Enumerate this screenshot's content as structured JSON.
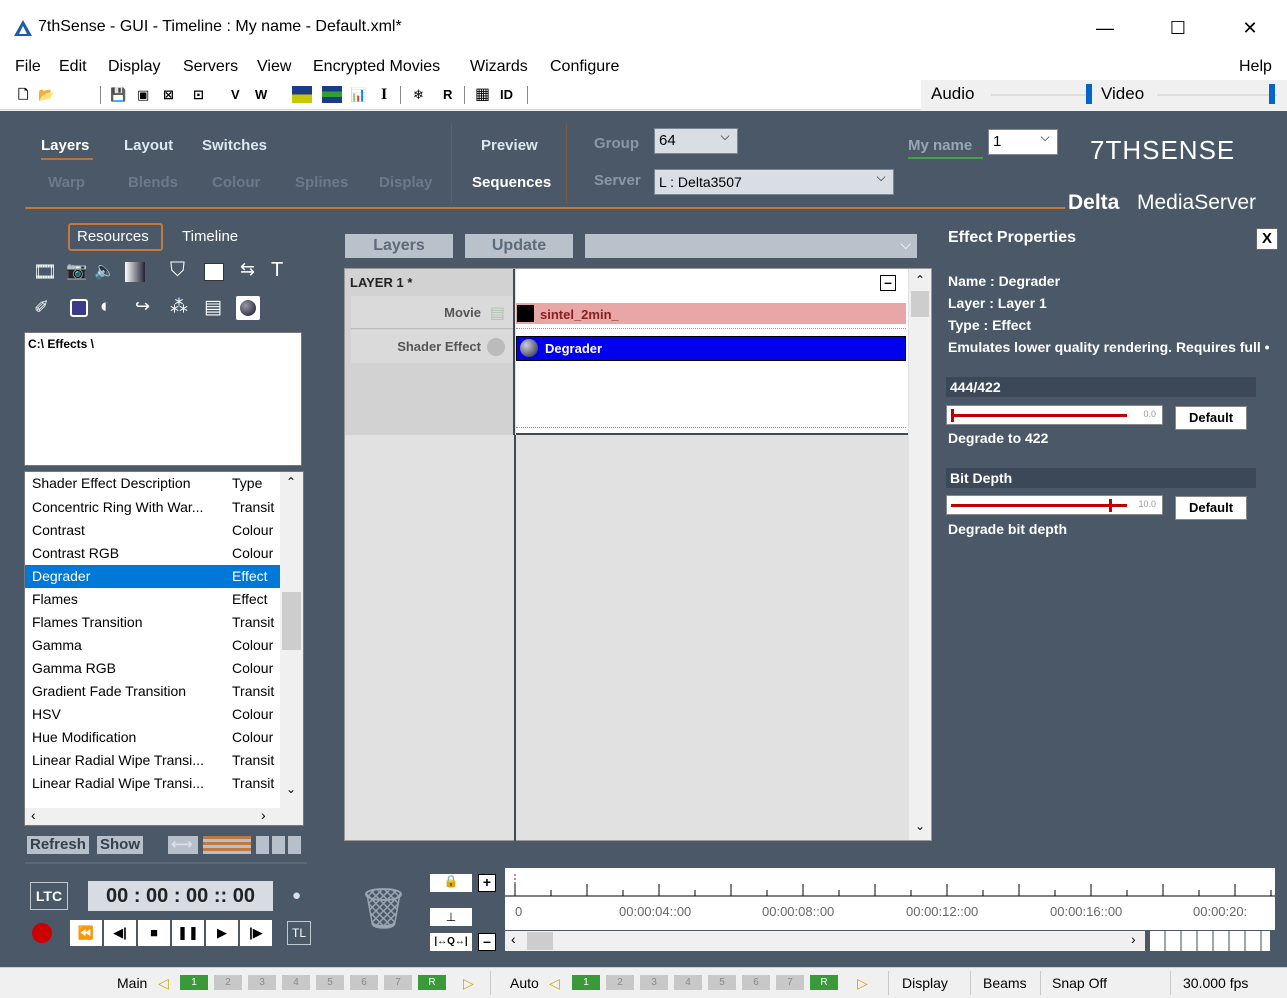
{
  "window": {
    "title": "7thSense -   GUI  - Timeline  : My name  - Default.xml*",
    "minimize": "—",
    "maximize": "☐",
    "close": "✕"
  },
  "menu": [
    "File",
    "Edit",
    "Display",
    "Servers",
    "View",
    "Encrypted Movies",
    "Wizards",
    "Configure",
    "Help"
  ],
  "toolbar": {
    "icons": [
      "new-file",
      "open-folder",
      "save",
      "properties",
      "grid-a",
      "grid-b",
      "V",
      "W",
      "chart-a",
      "chart-b",
      "bars",
      "I",
      "snowflake",
      "R",
      "table",
      "ID"
    ],
    "letter_v": "V",
    "letter_w": "W",
    "letter_i": "I",
    "letter_r": "R",
    "letter_id": "ID",
    "audio_label": "Audio",
    "video_label": "Video",
    "audio_level": 0.95,
    "video_level": 0.98
  },
  "nav": {
    "row1": [
      "Layers",
      "Layout",
      "Switches"
    ],
    "row2": [
      "Warp",
      "Blends",
      "Colour",
      "Splines",
      "Display"
    ],
    "preview": "Preview",
    "sequences": "Sequences",
    "group_label": "Group",
    "group_value": "64",
    "server_label": "Server",
    "server_value": "L : Delta3507",
    "user_label": "My name",
    "user_value": "1",
    "brand": "7THSENSE",
    "product_bold": "Delta",
    "product_light": "MediaServer"
  },
  "left": {
    "tab_resources": "Resources",
    "tab_timeline": "Timeline",
    "path": "C:\\ Effects \\",
    "col_desc": "Shader Effect Description",
    "col_type": "Type",
    "rows": [
      {
        "desc": "Concentric Ring With War...",
        "type": "Transit"
      },
      {
        "desc": "Contrast",
        "type": "Colour"
      },
      {
        "desc": "Contrast RGB",
        "type": "Colour"
      },
      {
        "desc": "Degrader",
        "type": "Effect",
        "selected": true
      },
      {
        "desc": "Flames",
        "type": "Effect"
      },
      {
        "desc": "Flames Transition",
        "type": "Transit"
      },
      {
        "desc": "Gamma",
        "type": "Colour"
      },
      {
        "desc": "Gamma RGB",
        "type": "Colour"
      },
      {
        "desc": "Gradient Fade Transition",
        "type": "Transit"
      },
      {
        "desc": "HSV",
        "type": "Colour"
      },
      {
        "desc": "Hue Modification",
        "type": "Colour"
      },
      {
        "desc": "Linear Radial Wipe Transi...",
        "type": "Transit"
      },
      {
        "desc": "Linear Radial Wipe Transi...",
        "type": "Transit"
      }
    ],
    "refresh": "Refresh",
    "show": "Show"
  },
  "center": {
    "btn_layers": "Layers",
    "btn_update": "Update",
    "layer_name": "LAYER 1 *",
    "track_movie": "Movie",
    "track_shader": "Shader Effect",
    "clip_movie": "sintel_2min_",
    "clip_shader": "Degrader"
  },
  "props": {
    "title": "Effect Properties",
    "close": "X",
    "name": "Name : Degrader",
    "layer": "Layer : Layer 1",
    "type": "Type : Effect",
    "desc": "Emulates lower quality rendering. Requires full •",
    "p1_head": "444/422",
    "p1_value": "0.0",
    "p1_fraction": 0.0,
    "p1_caption": "Degrade to 422",
    "p2_head": "Bit Depth",
    "p2_value": "10.0",
    "p2_fraction": 0.9,
    "p2_caption": "Degrade bit depth",
    "default": "Default"
  },
  "transport": {
    "ltc": "LTC",
    "timecode": "00 : 00 : 00 :: 00",
    "tl": "TL"
  },
  "timeline": {
    "ticks": [
      "0",
      "00:00:04::00",
      "00:00:08::00",
      "00:00:12::00",
      "00:00:16::00",
      "00:00:20:"
    ]
  },
  "status": {
    "main": "Main",
    "auto": "Auto",
    "segments": [
      "1",
      "2",
      "3",
      "4",
      "5",
      "6",
      "7",
      "R"
    ],
    "display": "Display",
    "beams": "Beams",
    "snap": "Snap Off",
    "fps": "30.000 fps"
  },
  "colors": {
    "bg_dark": "#4a5868",
    "accent_orange": "#c07a40",
    "selection_blue": "#0078d7",
    "clip_blue": "#0000ee",
    "clip_pink": "#e8a6a6",
    "slider_red": "#c00000"
  }
}
